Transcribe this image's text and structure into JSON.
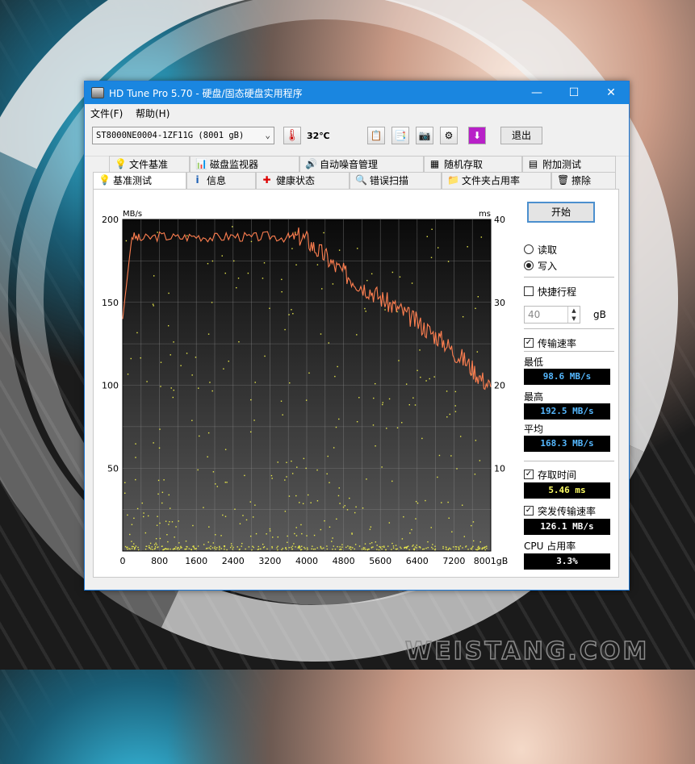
{
  "window": {
    "title": "HD Tune Pro 5.70 - 硬盘/固态硬盘实用程序",
    "minimize": "—",
    "maximize": "☐",
    "close": "✕"
  },
  "menu": [
    "文件(F)",
    "帮助(H)"
  ],
  "toolbar": {
    "drive": "ST8000NE0004-1ZF11G (8001 gB)",
    "temperature": "32℃",
    "exit_label": "退出"
  },
  "tabs_top": [
    {
      "label": "文件基准",
      "icon": "lightbulb-icon"
    },
    {
      "label": "磁盘监视器",
      "icon": "monitor-chart-icon"
    },
    {
      "label": "自动噪音管理",
      "icon": "speaker-icon"
    },
    {
      "label": "随机存取",
      "icon": "random-dots-icon"
    },
    {
      "label": "附加测试",
      "icon": "calculator-icon"
    }
  ],
  "tabs_bottom": [
    {
      "label": "基准测试",
      "icon": "lightbulb-icon",
      "active": true
    },
    {
      "label": "信息",
      "icon": "info-icon"
    },
    {
      "label": "健康状态",
      "icon": "health-cross-icon"
    },
    {
      "label": "错误扫描",
      "icon": "magnifier-icon"
    },
    {
      "label": "文件夹占用率",
      "icon": "folder-icon"
    },
    {
      "label": "擦除",
      "icon": "trash-icon"
    }
  ],
  "panel": {
    "start_label": "开始",
    "read_label": "读取",
    "write_label": "写入",
    "mode": "write",
    "quick_label": "快捷行程",
    "quick_checked": false,
    "quick_value": "40",
    "quick_unit": "gB",
    "transfer_label": "传输速率",
    "transfer_checked": true,
    "min_label": "最低",
    "min_value": "98.6 MB/s",
    "max_label": "最高",
    "max_value": "192.5 MB/s",
    "avg_label": "平均",
    "avg_value": "168.3 MB/s",
    "access_label": "存取时间",
    "access_checked": true,
    "access_value": "5.46 ms",
    "burst_label": "突发传输速率",
    "burst_checked": true,
    "burst_value": "126.1 MB/s",
    "cpu_label": "CPU 占用率",
    "cpu_value": "3.3%"
  },
  "chart_data": {
    "type": "line",
    "y_left_unit": "MB/s",
    "y_right_unit": "ms",
    "y_left_ticks": [
      "200",
      "150",
      "100",
      "50"
    ],
    "y_right_ticks": [
      "40",
      "30",
      "20",
      "10"
    ],
    "x_ticks": [
      "0",
      "800",
      "1600",
      "2400",
      "3200",
      "4000",
      "4800",
      "5600",
      "6400",
      "7200",
      "8001gB"
    ],
    "xlim": [
      0,
      8001
    ],
    "ylim": [
      0,
      200
    ],
    "y2lim": [
      0,
      40
    ],
    "series": [
      {
        "color": "#ff7f50",
        "x": [
          0,
          200,
          400,
          800,
          1200,
          1600,
          2000,
          2400,
          2800,
          3200,
          3600,
          3800,
          4000,
          4200,
          4400,
          4600,
          4800,
          5000,
          5200,
          5400,
          5600,
          5800,
          6000,
          6200,
          6400,
          6600,
          6800,
          7000,
          7200,
          7400,
          7600,
          7800,
          8001
        ],
        "values": [
          140,
          190,
          188,
          190,
          189,
          190,
          189,
          190,
          189,
          190,
          189,
          190,
          188,
          182,
          178,
          172,
          168,
          164,
          160,
          157,
          153,
          149,
          146,
          142,
          138,
          134,
          130,
          126,
          120,
          116,
          110,
          104,
          99
        ]
      }
    ],
    "access_points_ms_note": "",
    "grid": true
  }
}
